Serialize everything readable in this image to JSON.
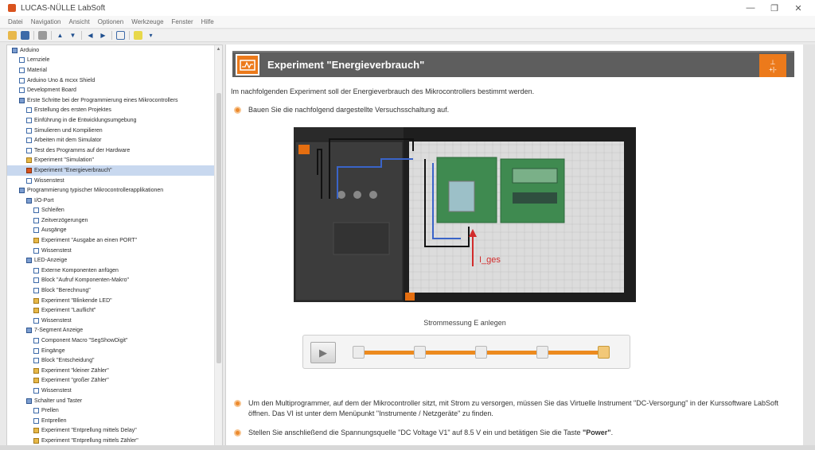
{
  "window": {
    "title": "LUCAS-NÜLLE LabSoft",
    "controls": [
      "—",
      "❐",
      "✕"
    ]
  },
  "menu": [
    "Datei",
    "Navigation",
    "Ansicht",
    "Optionen",
    "Werkzeuge",
    "Fenster",
    "Hilfe"
  ],
  "sidebar": {
    "items": [
      {
        "label": "Arduino",
        "level": 0,
        "type": "folder"
      },
      {
        "label": "Lernziele",
        "level": 1,
        "type": "page"
      },
      {
        "label": "Material",
        "level": 1,
        "type": "page"
      },
      {
        "label": "Arduino Uno & mcxx Shield",
        "level": 1,
        "type": "page"
      },
      {
        "label": "Development Board",
        "level": 1,
        "type": "page"
      },
      {
        "label": "Erste Schritte bei der Programmierung eines Mikrocontrollers",
        "level": 1,
        "type": "folder"
      },
      {
        "label": "Erstellung des ersten Projektes",
        "level": 2,
        "type": "page"
      },
      {
        "label": "Einführung in die Entwicklungsumgebung",
        "level": 2,
        "type": "page"
      },
      {
        "label": "Simulieren und Kompilieren",
        "level": 2,
        "type": "page"
      },
      {
        "label": "Arbeiten mit dem Simulator",
        "level": 2,
        "type": "page"
      },
      {
        "label": "Test des Programms auf der Hardware",
        "level": 2,
        "type": "page"
      },
      {
        "label": "Experiment \"Simulation\"",
        "level": 2,
        "type": "exp"
      },
      {
        "label": "Experiment \"Energieverbrauch\"",
        "level": 2,
        "type": "sel",
        "selected": true
      },
      {
        "label": "Wissenstest",
        "level": 2,
        "type": "page"
      },
      {
        "label": "Programmierung typischer Mikrocontrollerapplikationen",
        "level": 1,
        "type": "folder"
      },
      {
        "label": "I/O-Port",
        "level": 2,
        "type": "folder"
      },
      {
        "label": "Schleifen",
        "level": 3,
        "type": "page"
      },
      {
        "label": "Zeitverzögerungen",
        "level": 3,
        "type": "page"
      },
      {
        "label": "Ausgänge",
        "level": 3,
        "type": "page"
      },
      {
        "label": "Experiment \"Ausgabe an einen PORT\"",
        "level": 3,
        "type": "exp"
      },
      {
        "label": "Wissenstest",
        "level": 3,
        "type": "page"
      },
      {
        "label": "LED-Anzeige",
        "level": 2,
        "type": "folder"
      },
      {
        "label": "Externe Komponenten anfügen",
        "level": 3,
        "type": "page"
      },
      {
        "label": "Block \"Aufruf Komponenten-Makro\"",
        "level": 3,
        "type": "page"
      },
      {
        "label": "Block \"Berechnung\"",
        "level": 3,
        "type": "page"
      },
      {
        "label": "Experiment \"Blinkende LED\"",
        "level": 3,
        "type": "exp"
      },
      {
        "label": "Experiment \"Lauflicht\"",
        "level": 3,
        "type": "exp"
      },
      {
        "label": "Wissenstest",
        "level": 3,
        "type": "page"
      },
      {
        "label": "7-Segment Anzeige",
        "level": 2,
        "type": "folder"
      },
      {
        "label": "Component Macro \"SegShowDigit\"",
        "level": 3,
        "type": "page"
      },
      {
        "label": "Eingänge",
        "level": 3,
        "type": "page"
      },
      {
        "label": "Block \"Entscheidung\"",
        "level": 3,
        "type": "page"
      },
      {
        "label": "Experiment \"kleiner Zähler\"",
        "level": 3,
        "type": "exp"
      },
      {
        "label": "Experiment \"großer Zähler\"",
        "level": 3,
        "type": "exp"
      },
      {
        "label": "Wissenstest",
        "level": 3,
        "type": "page"
      },
      {
        "label": "Schalter und Taster",
        "level": 2,
        "type": "folder"
      },
      {
        "label": "Prellen",
        "level": 3,
        "type": "page"
      },
      {
        "label": "Entprellen",
        "level": 3,
        "type": "page"
      },
      {
        "label": "Experiment \"Entprellung mittels Delay\"",
        "level": 3,
        "type": "exp"
      },
      {
        "label": "Experiment \"Entprellung mittels Zähler\"",
        "level": 3,
        "type": "exp"
      }
    ]
  },
  "content": {
    "title": "Experiment \"Energieverbrauch\"",
    "header_badge": "+|-",
    "intro": "Im nachfolgenden Experiment soll der Energieverbrauch des Mikrocontrollers bestimmt werden.",
    "step1": "Bauen Sie die nachfolgend dargestellte Versuchsschaltung auf.",
    "figure_current_label": "I_ges",
    "caption": "Strommessung E anlegen",
    "player": {
      "steps": 5,
      "active_step": 5
    },
    "step2": "Um den Multiprogrammer, auf dem der Mikrocontroller sitzt, mit Strom zu versorgen, müssen Sie das Virtuelle Instrument \"DC-Versorgung\" in der Kurssoftware LabSoft öffnen. Das VI ist unter dem Menüpunkt \"Instrumente / Netzgeräte\" zu finden.",
    "step3_prefix": "Stellen Sie anschließend die Spannungsquelle \"DC Voltage V1\" auf 8.5 V ein und betätigen Sie die Taste ",
    "step3_strong": "\"Power\"",
    "step3_suffix": "."
  }
}
